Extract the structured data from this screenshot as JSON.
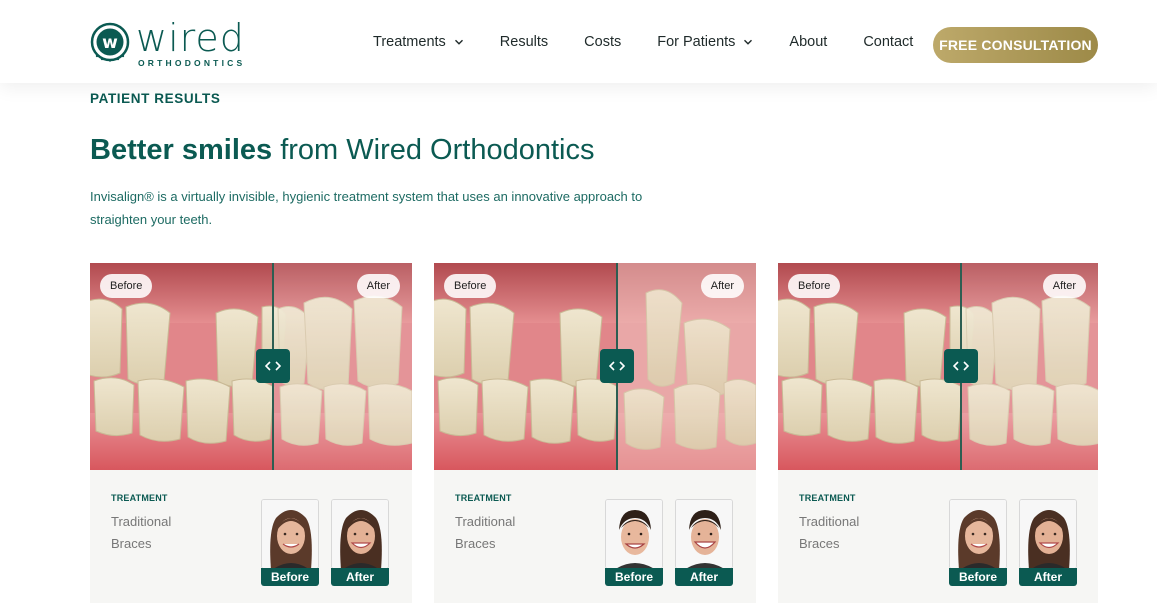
{
  "brand": {
    "logo_letter": "w",
    "logo_word": "wired",
    "logo_sub": "ORTHODONTICS",
    "primary": "#0b5a52",
    "gold": "#b09c5a"
  },
  "nav": {
    "items": [
      {
        "label": "Treatments",
        "dropdown": true
      },
      {
        "label": "Results",
        "dropdown": false
      },
      {
        "label": "Costs",
        "dropdown": false
      },
      {
        "label": "For Patients",
        "dropdown": true
      },
      {
        "label": "About",
        "dropdown": false
      },
      {
        "label": "Contact",
        "dropdown": false
      }
    ],
    "cta": "FREE CONSULTATION"
  },
  "hero": {
    "eyebrow": "PATIENT RESULTS",
    "title_strong": "Better smiles",
    "title_rest": "from Wired Orthodontics",
    "intro": "Invisalign® is a virtually invisible, hygienic treatment system that uses an innovative approach to straighten your teeth."
  },
  "cards": [
    {
      "before_label": "Before",
      "after_label": "After",
      "treatment_label": "TREATMENT",
      "treatment_value": "Traditional Braces",
      "thumb_before": "Before",
      "thumb_after": "After",
      "patient": "woman"
    },
    {
      "before_label": "Before",
      "after_label": "After",
      "treatment_label": "TREATMENT",
      "treatment_value": "Traditional Braces",
      "thumb_before": "Before",
      "thumb_after": "After",
      "patient": "boy"
    },
    {
      "before_label": "Before",
      "after_label": "After",
      "treatment_label": "TREATMENT",
      "treatment_value": "Traditional Braces",
      "thumb_before": "Before",
      "thumb_after": "After",
      "patient": "woman"
    }
  ],
  "icons": {
    "chevron": "chevron-down-icon",
    "handle": "compare-arrows-icon"
  }
}
